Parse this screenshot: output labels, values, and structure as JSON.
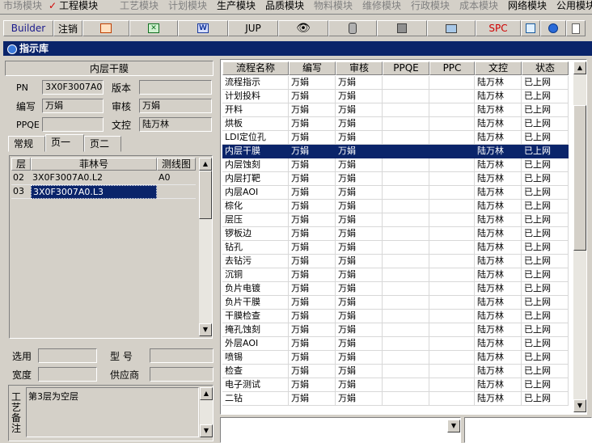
{
  "menu": [
    {
      "label": "市场模块",
      "active": false
    },
    {
      "label": "工程模块",
      "active": true
    },
    {
      "label": "工艺模块",
      "active": false
    },
    {
      "label": "计划模块",
      "active": false
    },
    {
      "label": "生产模块",
      "active": true
    },
    {
      "label": "品质模块",
      "active": true
    },
    {
      "label": "物料模块",
      "active": false
    },
    {
      "label": "维修模块",
      "active": false
    },
    {
      "label": "行政模块",
      "active": false
    },
    {
      "label": "成本模块",
      "active": false
    },
    {
      "label": "网络模块",
      "active": true
    },
    {
      "label": "公用模块",
      "active": true
    }
  ],
  "toolbar": {
    "builder": "Builder",
    "logout": "注销",
    "jup": "JUP",
    "spc": "SPC"
  },
  "window": {
    "title": "指示库"
  },
  "left": {
    "panel_title": "内层干膜",
    "pn_label": "PN",
    "pn_value": "3X0F3007A0",
    "version_label": "版本",
    "version_value": "",
    "author_label": "编写",
    "author_value": "万娟",
    "review_label": "审核",
    "review_value": "万娟",
    "ppqe_label": "PPQE",
    "ppqe_value": "",
    "doc_label": "文控",
    "doc_value": "陆万林",
    "tabs": [
      "常规",
      "页一",
      "页二"
    ],
    "table_headers": [
      "层",
      "菲林号",
      "测线图"
    ],
    "table_rows": [
      {
        "layer": "02",
        "film": "3X0F3007A0.L2",
        "test": "A0"
      },
      {
        "layer": "03",
        "film": "3X0F3007A0.L3",
        "test": ""
      }
    ],
    "use_label": "选用",
    "model_label": "型  号",
    "width_label": "宽度",
    "supplier_label": "供应商",
    "notes_label": "工艺备注",
    "notes_text": "第3层为空层"
  },
  "grid": {
    "headers": [
      "流程名称",
      "编写",
      "审核",
      "PPQE",
      "PPC",
      "文控",
      "状态"
    ],
    "rows": [
      [
        "流程指示",
        "万娟",
        "万娟",
        "",
        "",
        "陆万林",
        "已上网"
      ],
      [
        "计划投料",
        "万娟",
        "万娟",
        "",
        "",
        "陆万林",
        "已上网"
      ],
      [
        "开料",
        "万娟",
        "万娟",
        "",
        "",
        "陆万林",
        "已上网"
      ],
      [
        "烘板",
        "万娟",
        "万娟",
        "",
        "",
        "陆万林",
        "已上网"
      ],
      [
        "LDI定位孔",
        "万娟",
        "万娟",
        "",
        "",
        "陆万林",
        "已上网"
      ],
      [
        "内层干膜",
        "万娟",
        "万娟",
        "",
        "",
        "陆万林",
        "已上网"
      ],
      [
        "内层蚀刻",
        "万娟",
        "万娟",
        "",
        "",
        "陆万林",
        "已上网"
      ],
      [
        "内层打靶",
        "万娟",
        "万娟",
        "",
        "",
        "陆万林",
        "已上网"
      ],
      [
        "内层AOI",
        "万娟",
        "万娟",
        "",
        "",
        "陆万林",
        "已上网"
      ],
      [
        "棕化",
        "万娟",
        "万娟",
        "",
        "",
        "陆万林",
        "已上网"
      ],
      [
        "层压",
        "万娟",
        "万娟",
        "",
        "",
        "陆万林",
        "已上网"
      ],
      [
        "锣板边",
        "万娟",
        "万娟",
        "",
        "",
        "陆万林",
        "已上网"
      ],
      [
        "钻孔",
        "万娟",
        "万娟",
        "",
        "",
        "陆万林",
        "已上网"
      ],
      [
        "去钻污",
        "万娟",
        "万娟",
        "",
        "",
        "陆万林",
        "已上网"
      ],
      [
        "沉铜",
        "万娟",
        "万娟",
        "",
        "",
        "陆万林",
        "已上网"
      ],
      [
        "负片电镀",
        "万娟",
        "万娟",
        "",
        "",
        "陆万林",
        "已上网"
      ],
      [
        "负片干膜",
        "万娟",
        "万娟",
        "",
        "",
        "陆万林",
        "已上网"
      ],
      [
        "干膜检查",
        "万娟",
        "万娟",
        "",
        "",
        "陆万林",
        "已上网"
      ],
      [
        "掩孔蚀刻",
        "万娟",
        "万娟",
        "",
        "",
        "陆万林",
        "已上网"
      ],
      [
        "外层AOI",
        "万娟",
        "万娟",
        "",
        "",
        "陆万林",
        "已上网"
      ],
      [
        "喷锡",
        "万娟",
        "万娟",
        "",
        "",
        "陆万林",
        "已上网"
      ],
      [
        "检查",
        "万娟",
        "万娟",
        "",
        "",
        "陆万林",
        "已上网"
      ],
      [
        "电子测试",
        "万娟",
        "万娟",
        "",
        "",
        "陆万林",
        "已上网"
      ],
      [
        "二钻",
        "万娟",
        "万娟",
        "",
        "",
        "陆万林",
        "已上网"
      ]
    ],
    "selected_index": 5
  }
}
